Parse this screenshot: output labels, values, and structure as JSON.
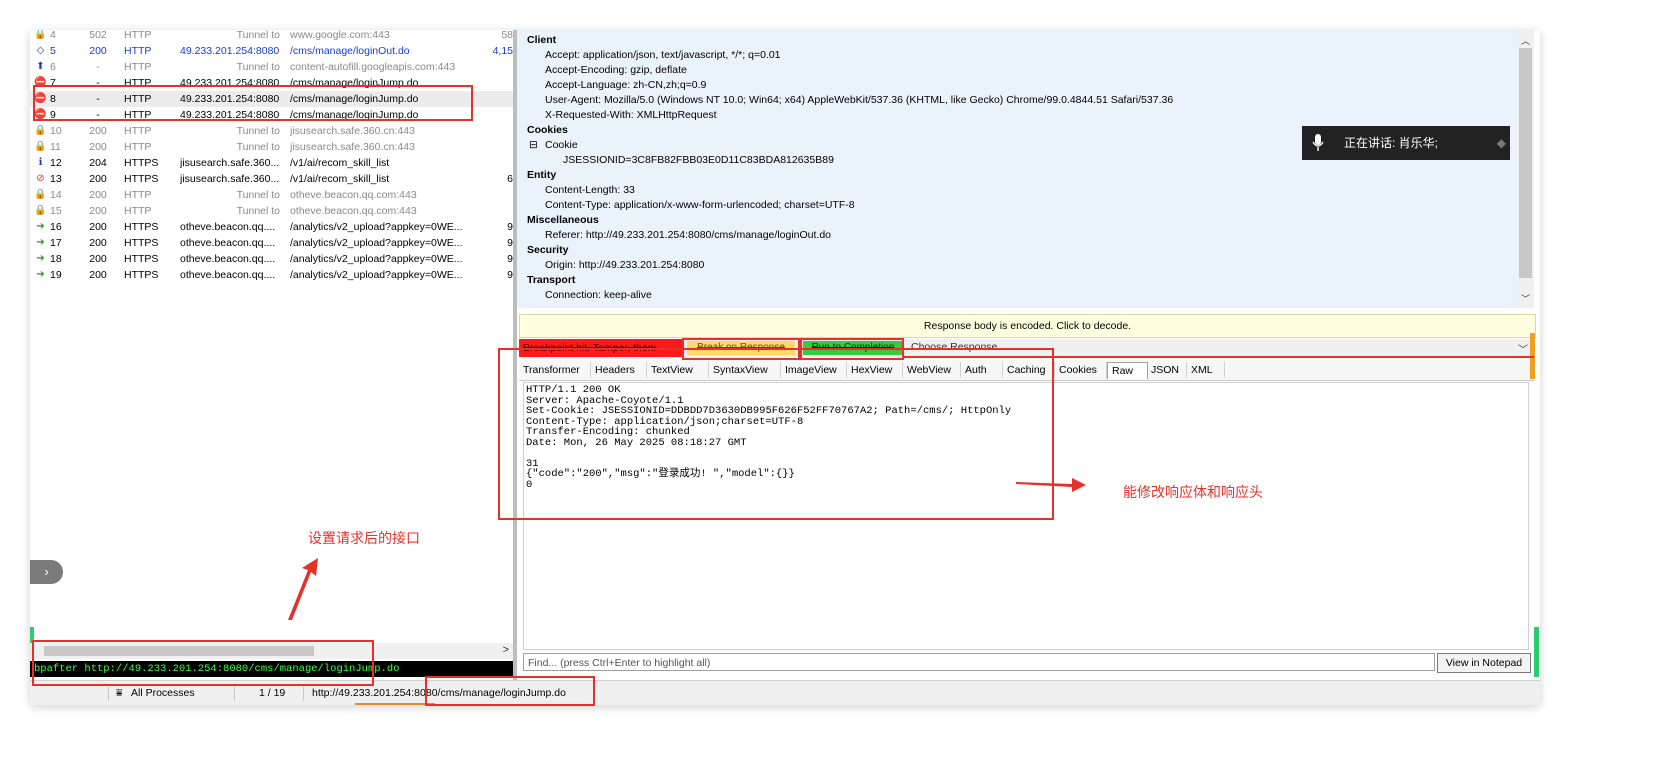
{
  "sessions": [
    {
      "num": "4",
      "result": "502",
      "protocol": "HTTP",
      "host": "Tunnel to",
      "url": "www.google.com:443",
      "body": "58",
      "icon": "lock-icon",
      "style": "gray"
    },
    {
      "num": "5",
      "result": "200",
      "protocol": "HTTP",
      "host": "49.233.201.254:8080",
      "url": "/cms/manage/loginOut.do",
      "body": "4,15",
      "icon": "diamond-arrows-icon",
      "style": "blue"
    },
    {
      "num": "6",
      "result": "-",
      "protocol": "HTTP",
      "host": "Tunnel to",
      "url": "content-autofill.googleapis.com:443",
      "body": "",
      "icon": "up-arrow-icon",
      "style": "gray"
    },
    {
      "num": "7",
      "result": "-",
      "protocol": "HTTP",
      "host": "49.233.201.254:8080",
      "url": "/cms/manage/loginJump.do",
      "body": "",
      "icon": "breakpoint-icon",
      "style": "normal"
    },
    {
      "num": "8",
      "result": "-",
      "protocol": "HTTP",
      "host": "49.233.201.254:8080",
      "url": "/cms/manage/loginJump.do",
      "body": "",
      "icon": "breakpoint-icon",
      "style": "sel"
    },
    {
      "num": "9",
      "result": "-",
      "protocol": "HTTP",
      "host": "49.233.201.254:8080",
      "url": "/cms/manage/loginJump.do",
      "body": "",
      "icon": "breakpoint-icon",
      "style": "normal"
    },
    {
      "num": "10",
      "result": "200",
      "protocol": "HTTP",
      "host": "Tunnel to",
      "url": "jisusearch.safe.360.cn:443",
      "body": "",
      "icon": "lock-icon",
      "style": "gray"
    },
    {
      "num": "11",
      "result": "200",
      "protocol": "HTTP",
      "host": "Tunnel to",
      "url": "jisusearch.safe.360.cn:443",
      "body": "",
      "icon": "lock-icon",
      "style": "gray"
    },
    {
      "num": "12",
      "result": "204",
      "protocol": "HTTPS",
      "host": "jisusearch.safe.360....",
      "url": "/v1/ai/recom_skill_list",
      "body": "",
      "icon": "info-icon",
      "style": "normal"
    },
    {
      "num": "13",
      "result": "200",
      "protocol": "HTTPS",
      "host": "jisusearch.safe.360....",
      "url": "/v1/ai/recom_skill_list",
      "body": "6",
      "icon": "blocked-icon",
      "style": "normal"
    },
    {
      "num": "14",
      "result": "200",
      "protocol": "HTTP",
      "host": "Tunnel to",
      "url": "otheve.beacon.qq.com:443",
      "body": "",
      "icon": "lock-icon",
      "style": "gray"
    },
    {
      "num": "15",
      "result": "200",
      "protocol": "HTTP",
      "host": "Tunnel to",
      "url": "otheve.beacon.qq.com:443",
      "body": "",
      "icon": "lock-icon",
      "style": "gray"
    },
    {
      "num": "16",
      "result": "200",
      "protocol": "HTTPS",
      "host": "otheve.beacon.qq....",
      "url": "/analytics/v2_upload?appkey=0WE...",
      "body": "9",
      "icon": "post-icon",
      "style": "normal"
    },
    {
      "num": "17",
      "result": "200",
      "protocol": "HTTPS",
      "host": "otheve.beacon.qq....",
      "url": "/analytics/v2_upload?appkey=0WE...",
      "body": "9",
      "icon": "post-icon",
      "style": "normal"
    },
    {
      "num": "18",
      "result": "200",
      "protocol": "HTTPS",
      "host": "otheve.beacon.qq....",
      "url": "/analytics/v2_upload?appkey=0WE...",
      "body": "9",
      "icon": "post-icon",
      "style": "normal"
    },
    {
      "num": "19",
      "result": "200",
      "protocol": "HTTPS",
      "host": "otheve.beacon.qq....",
      "url": "/analytics/v2_upload?appkey=0WE...",
      "body": "9",
      "icon": "post-icon",
      "style": "normal"
    }
  ],
  "command_line": "bpafter http://49.233.201.254:8080/cms/manage/loginJump.do",
  "status_bar": {
    "filter": "All Processes",
    "count": "1 / 19",
    "url": "http://49.233.201.254:8080/cms/manage/loginJump.do"
  },
  "request_headers": {
    "client_title": "Client",
    "client": [
      "Accept: application/json, text/javascript, */*; q=0.01",
      "Accept-Encoding: gzip, deflate",
      "Accept-Language: zh-CN,zh;q=0.9",
      "User-Agent: Mozilla/5.0 (Windows NT 10.0; Win64; x64) AppleWebKit/537.36 (KHTML, like Gecko) Chrome/99.0.4844.51 Safari/537.36",
      "X-Requested-With: XMLHttpRequest"
    ],
    "cookies_title": "Cookies",
    "cookie_label": "Cookie",
    "cookie_value": "JSESSIONID=3C8FB82FBB03E0D11C83BDA812635B89",
    "entity_title": "Entity",
    "entity": [
      "Content-Length: 33",
      "Content-Type: application/x-www-form-urlencoded; charset=UTF-8"
    ],
    "misc_title": "Miscellaneous",
    "misc": [
      "Referer: http://49.233.201.254:8080/cms/manage/loginOut.do"
    ],
    "security_title": "Security",
    "security": [
      "Origin: http://49.233.201.254:8080"
    ],
    "transport_title": "Transport",
    "transport": [
      "Connection: keep-alive"
    ]
  },
  "response_encoded_notice": "Response body is encoded. Click to decode.",
  "breakpoint_bar": {
    "hit_label": "Breakpoint hit. Tamper, then:",
    "break_on_response": "Break on Response",
    "run_to_completion": "Run to Completion",
    "choose_response": "Choose Response..."
  },
  "response_tabs": [
    "Transformer",
    "Headers",
    "TextView",
    "SyntaxView",
    "ImageView",
    "HexView",
    "WebView",
    "Auth",
    "Caching",
    "Cookies",
    "Raw",
    "JSON",
    "XML"
  ],
  "active_tab": "Raw",
  "raw_response": [
    "HTTP/1.1 200 OK",
    "Server: Apache-Coyote/1.1",
    "Set-Cookie: JSESSIONID=DDBDD7D3630DB995F626F52FF70767A2; Path=/cms/; HttpOnly",
    "Content-Type: application/json;charset=UTF-8",
    "Transfer-Encoding: chunked",
    "Date: Mon, 26 May 2025 08:18:27 GMT",
    "",
    "31",
    "{\"code\":\"200\",\"msg\":\"登录成功! \",\"model\":{}}",
    "0"
  ],
  "find_placeholder": "Find... (press Ctrl+Enter to highlight all)",
  "view_in_notepad": "View in Notepad",
  "speech_popup": "正在讲话:  肖乐华;",
  "annotations": {
    "left_note": "设置请求后的接口",
    "right_note": "能修改响应体和响应头"
  },
  "colors": {
    "annotation_red": "#e8302a",
    "header_bg": "#eaf3fb",
    "cmd_text": "#3cff3c"
  }
}
